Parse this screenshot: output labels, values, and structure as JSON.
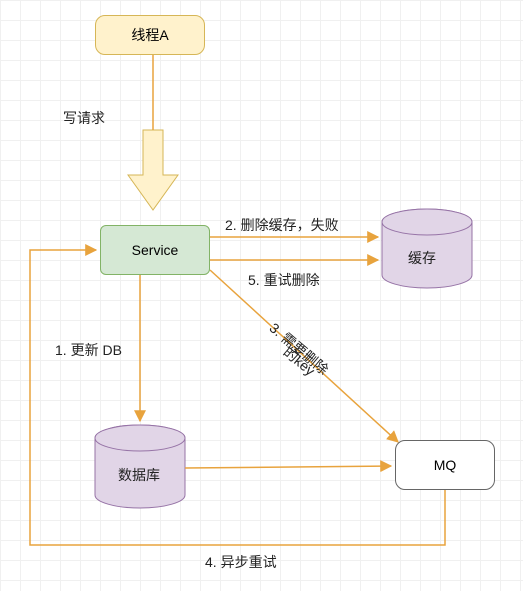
{
  "nodes": {
    "thread_a": "线程A",
    "service": "Service",
    "cache": "缓存",
    "database": "数据库",
    "mq": "MQ"
  },
  "edges": {
    "write_request": "写请求",
    "step1": "1. 更新 DB",
    "step2": "2. 删除缓存，失败",
    "step3_line1": "3. 需要删除",
    "step3_line2": "的key",
    "step4": "4. 异步重试",
    "step5": "5. 重试删除"
  },
  "colors": {
    "arrow_orange": "#e8a33d",
    "cylinder_fill": "#e1d5e7",
    "cylinder_stroke": "#9673a6"
  }
}
